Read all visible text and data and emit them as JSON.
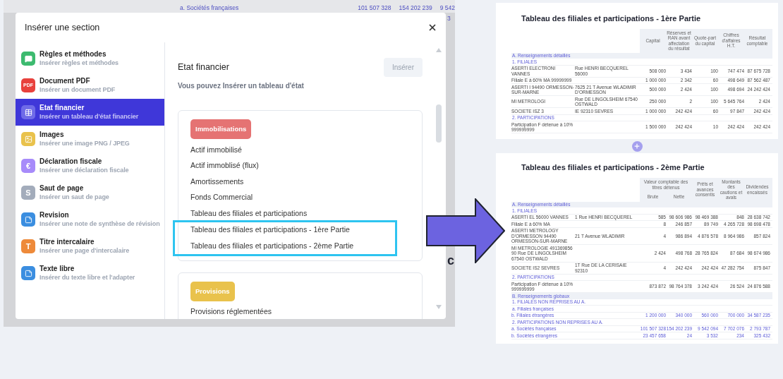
{
  "background": {
    "row": {
      "label": "a. Sociétés françaises",
      "values": [
        "101 507 328",
        "154 202 239",
        "9 542"
      ]
    },
    "fragments": [
      "3",
      "c"
    ]
  },
  "modal": {
    "title": "Insérer une section",
    "sidebar": [
      {
        "title": "Règles et méthodes",
        "subtitle": "Insérer règles et méthodes",
        "kind": "comment",
        "color": "#3dba6f",
        "selected": false
      },
      {
        "title": "Document PDF",
        "subtitle": "Insérer un document PDF",
        "kind": "text",
        "icon_text": "PDF",
        "color": "#e8413c",
        "selected": false
      },
      {
        "title": "Etat financier",
        "subtitle": "Insérer un tableau d'état financier",
        "kind": "table",
        "color": "#6f6be8",
        "selected": true
      },
      {
        "title": "Images",
        "subtitle": "Insérer une image PNG / JPEG",
        "kind": "image",
        "color": "#e9c24c",
        "selected": false
      },
      {
        "title": "Déclaration fiscale",
        "subtitle": "Insérer une déclaration fiscale",
        "kind": "text",
        "icon_text": "€",
        "color": "#a78bfa",
        "selected": false
      },
      {
        "title": "Saut de page",
        "subtitle": "Insérer un saut de page",
        "kind": "text",
        "icon_text": "S",
        "color": "#a3acbb",
        "selected": false
      },
      {
        "title": "Revision",
        "subtitle": "Insérer une note de synthèse de révision",
        "kind": "note",
        "color": "#3b8ee0",
        "selected": false
      },
      {
        "title": "Titre intercalaire",
        "subtitle": "Insérer une page d'intercalaire",
        "kind": "text",
        "icon_text": "T",
        "color": "#ee8a3a",
        "selected": false
      },
      {
        "title": "Texte libre",
        "subtitle": "Insérer du texte libre et l'adapter",
        "kind": "note",
        "color": "#3b8ee0",
        "selected": false
      }
    ],
    "content": {
      "title": "Etat financier",
      "insert_button": {
        "label": "Insérer",
        "disabled": true
      },
      "description": "Vous pouvez Insérer un tableau d'état",
      "categories": [
        {
          "label": "Immobilisations",
          "color": "#e57373",
          "items": [
            {
              "label": "Actif immobilisé",
              "highlighted": false
            },
            {
              "label": "Actif immoblisé (flux)",
              "highlighted": false
            },
            {
              "label": "Amortissements",
              "highlighted": false
            },
            {
              "label": "Fonds Commercial",
              "highlighted": false
            },
            {
              "label": "Tableau des filiales et participations",
              "highlighted": false
            },
            {
              "label": "Tableau des filiales et participations - 1ère Partie",
              "highlighted": true
            },
            {
              "label": "Tableau des filiales et participations - 2ème Partie",
              "highlighted": true
            }
          ]
        },
        {
          "label": "Provisions",
          "color": "#e9c24c",
          "items": [
            {
              "label": "Provisions réglementées",
              "highlighted": false
            }
          ]
        }
      ]
    }
  },
  "documents": [
    {
      "title": "Tableau des filiales et participations - 1ère Partie",
      "columns": [
        "Capital",
        "Réserves et RAN avant affectation du résultat",
        "Quote-part du capital",
        "Chiffres d'affaires H.T.",
        "Résultat comptable"
      ],
      "rows": [
        {
          "kind": "section",
          "label": "A. Renseignements détaillés"
        },
        {
          "kind": "group",
          "label": "1. FILIALES"
        },
        {
          "kind": "entity",
          "label": "ASERTI ELECTRONI VANNES",
          "address": "Rue HENRI BECQUEREL 56000",
          "values": [
            "508 000",
            "3 434",
            "100",
            "747 474",
            "87 675 728"
          ]
        },
        {
          "kind": "entity",
          "label": "Filiale E à 60% MA 99999999",
          "values": [
            "1 000 000",
            "2 342",
            "60",
            "498 649",
            "87 562 487"
          ]
        },
        {
          "kind": "entity",
          "label": "ASERTI I 94490 ORMESSON-SUR-MARNE",
          "address": "7625 21 T Avenue WLADIMIR D'ORMESSON",
          "values": [
            "500 000",
            "2 424",
            "100",
            "498 694",
            "24 242 424"
          ]
        },
        {
          "kind": "entity",
          "label": "MI METROLOGI",
          "address": "Rue DE LINGOLSHEIM 67540 OSTWALD",
          "values": [
            "250 000",
            "2",
            "100",
            "5 645 764",
            "2 424"
          ]
        },
        {
          "kind": "entity",
          "label": "SOCIETE ISZ 3",
          "address": "IE 92310 SEVRES",
          "values": [
            "1 000 000",
            "242 424",
            "60",
            "97 847",
            "242 424"
          ]
        },
        {
          "kind": "group",
          "label": "2. PARTICIPATIONS"
        },
        {
          "kind": "entity",
          "label": "Participation F détenue à 10% 999999999",
          "values": [
            "1 500 000",
            "242 424",
            "10",
            "242 424",
            "242 424"
          ]
        }
      ]
    },
    {
      "title": "Tableau des filiales et participations - 2ème Partie",
      "column_group": {
        "label": "Valeur comptable des titres détenus",
        "columns": [
          "Brute",
          "Nette"
        ]
      },
      "columns": [
        "Prêts et avances consentis",
        "Montants des cautions et avals",
        "Dividendes encaissés"
      ],
      "rows": [
        {
          "kind": "section",
          "label": "A. Renseignements détaillés"
        },
        {
          "kind": "group",
          "label": "1. FILIALES"
        },
        {
          "kind": "entity",
          "label": "ASERTI EL 56000 VANNES",
          "address": "1 Rue HENRI BECQUEREL",
          "values": [
            "585",
            "98 606 986",
            "98 469 388",
            "848",
            "28 638 742"
          ]
        },
        {
          "kind": "entity",
          "label": "Filiale E à 60% MA",
          "values": [
            "8",
            "246 857",
            "89 749",
            "4 265 728",
            "98 698 478"
          ]
        },
        {
          "kind": "entity",
          "label": "ASERTI METROLOGY D'ORMESSON 94490 ORMESSON-SUR-MARNE",
          "address": "21 T Avenue WLADIMIR",
          "values": [
            "4",
            "986 894",
            "4 876 578",
            "8 964 986",
            "857 824"
          ]
        },
        {
          "kind": "entity",
          "label": "MI METROLOGIE 491369856 90 Rue DE LINGOLSHEIM 67540 OSTWALD",
          "values": [
            "2 424",
            "498 768",
            "28 765 824",
            "87 684",
            "98 674 986"
          ]
        },
        {
          "kind": "entity",
          "label": "SOCIETE IS2 SEVRES",
          "address": "1T Rue DE LA CERISAIE 92310",
          "values": [
            "4",
            "242 424",
            "242 424",
            "47 282 754",
            "875 847"
          ]
        },
        {
          "kind": "group",
          "label": "2. PARTICIPATIONS"
        },
        {
          "kind": "entity",
          "label": "Participation F détenue à 10% 999999999",
          "values": [
            "873 872",
            "98 764 378",
            "3 242 424",
            "26 524",
            "24 876 588"
          ]
        },
        {
          "kind": "section",
          "label": "B. Renseignements globaux"
        },
        {
          "kind": "group",
          "label": "1. FILIALES NON REPRISES AU A."
        },
        {
          "kind": "group",
          "label": "a. Filiales françaises"
        },
        {
          "kind": "total",
          "label": "b. Filiales étrangères",
          "values": [
            "1 200 000",
            "340 000",
            "560 000",
            "700 000",
            "34 587 235"
          ]
        },
        {
          "kind": "group",
          "label": "2. PARTICIPATIONS NON REPRISES AU A."
        },
        {
          "kind": "total",
          "label": "a. Sociétés françaises",
          "values": [
            "101 507 328",
            "154 202 239",
            "9 542 094",
            "7 702 076",
            "2 793 787"
          ]
        },
        {
          "kind": "total",
          "label": "b. Sociétés étrangères",
          "values": [
            "23 457 658",
            "24",
            "3 532",
            "234",
            "325 432"
          ]
        }
      ]
    }
  ]
}
